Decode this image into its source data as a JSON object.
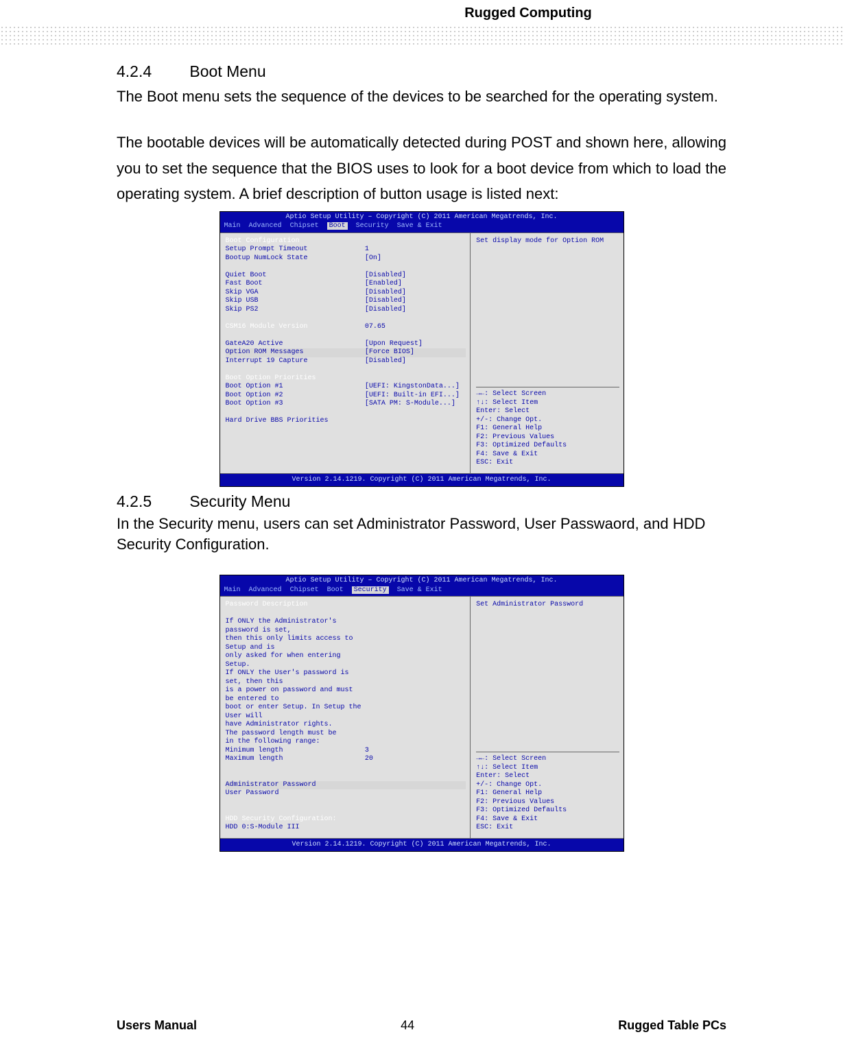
{
  "header": {
    "brand": "Rugged Computing"
  },
  "section1": {
    "num": "4.2.4",
    "title": "Boot Menu",
    "para1": "The Boot menu sets the sequence of the devices to be searched for the operating system.",
    "para2": "The bootable devices will be automatically detected during POST and shown here, allowing you to set the sequence that the BIOS uses to look for a boot device from which to load the operating system. A brief description of button usage is listed next:"
  },
  "section2": {
    "num": "4.2.5",
    "title": "Security Menu",
    "para1": "In the Security menu, users can set Administrator Password, User Passwaord, and HDD Security Configuration."
  },
  "bios_common": {
    "title": "Aptio Setup Utility – Copyright (C) 2011 American Megatrends, Inc.",
    "tabs": {
      "t1": "Main",
      "t2": "Advanced",
      "t3": "Chipset",
      "t4": "Boot",
      "t5": "Security",
      "t6": "Save & Exit"
    },
    "footer": "Version 2.14.1219. Copyright (C) 2011 American Megatrends, Inc.",
    "help_keys": {
      "l1": "→←: Select Screen",
      "l2": "↑↓: Select Item",
      "l3": "Enter: Select",
      "l4": "+/-: Change Opt.",
      "l5": "F1: General Help",
      "l6": "F2: Previous Values",
      "l7": "F3: Optimized Defaults",
      "l8": "F4: Save & Exit",
      "l9": "ESC: Exit"
    }
  },
  "bios1": {
    "help_top": "Set display mode for Option ROM",
    "rows": [
      {
        "k": "Boot Configuration",
        "v": "",
        "white": true
      },
      {
        "k": "Setup Prompt Timeout",
        "v": "1"
      },
      {
        "k": "Bootup NumLock State",
        "v": "[On]"
      },
      {
        "k": "",
        "v": ""
      },
      {
        "k": "Quiet Boot",
        "v": "[Disabled]"
      },
      {
        "k": "Fast Boot",
        "v": "[Enabled]"
      },
      {
        "k": " Skip VGA",
        "v": "[Disabled]"
      },
      {
        "k": " Skip USB",
        "v": "[Disabled]"
      },
      {
        "k": " Skip PS2",
        "v": "[Disabled]"
      },
      {
        "k": "",
        "v": ""
      },
      {
        "k": "CSM16 Module Version",
        "v": "07.65",
        "white": true
      },
      {
        "k": "",
        "v": ""
      },
      {
        "k": "GateA20 Active",
        "v": "[Upon Request]"
      },
      {
        "k": "Option ROM Messages",
        "v": "[Force BIOS]",
        "hl": true
      },
      {
        "k": "Interrupt 19 Capture",
        "v": "[Disabled]"
      },
      {
        "k": "",
        "v": ""
      },
      {
        "k": "Boot Option Priorities",
        "v": "",
        "white": true
      },
      {
        "k": "Boot Option #1",
        "v": "[UEFI: KingstonData...]"
      },
      {
        "k": "Boot Option #2",
        "v": "[UEFI: Built-in EFI...]"
      },
      {
        "k": "Boot Option #3",
        "v": "[SATA  PM: S-Module...]"
      },
      {
        "k": "",
        "v": ""
      },
      {
        "k": "Hard Drive BBS Priorities",
        "v": ""
      }
    ]
  },
  "bios2": {
    "help_top": "Set Administrator Password",
    "rows": [
      {
        "k": "Password Description",
        "v": "",
        "white": true
      },
      {
        "k": "",
        "v": ""
      },
      {
        "k": "If ONLY the Administrator's password is set,",
        "v": ""
      },
      {
        "k": "then this only limits access to Setup and is",
        "v": ""
      },
      {
        "k": "only asked for when entering Setup.",
        "v": ""
      },
      {
        "k": "If ONLY the User's password is set, then this",
        "v": ""
      },
      {
        "k": "is a power on password and must be entered to",
        "v": ""
      },
      {
        "k": "boot or enter Setup. In Setup the User will",
        "v": ""
      },
      {
        "k": "have Administrator rights.",
        "v": ""
      },
      {
        "k": "The password length must be",
        "v": ""
      },
      {
        "k": "in the following range:",
        "v": ""
      },
      {
        "k": "Minimum length",
        "v": "3"
      },
      {
        "k": "Maximum length",
        "v": "20"
      },
      {
        "k": "",
        "v": ""
      },
      {
        "k": "",
        "v": ""
      },
      {
        "k": "Administrator Password",
        "v": "",
        "hl": true
      },
      {
        "k": "User Password",
        "v": ""
      },
      {
        "k": "",
        "v": ""
      },
      {
        "k": "",
        "v": ""
      },
      {
        "k": "HDD Security Configuration:",
        "v": "",
        "white": true
      },
      {
        "k": "HDD 0:S-Module III",
        "v": ""
      }
    ]
  },
  "footer": {
    "left": "Users Manual",
    "center": "44",
    "right": "Rugged Table PCs"
  }
}
